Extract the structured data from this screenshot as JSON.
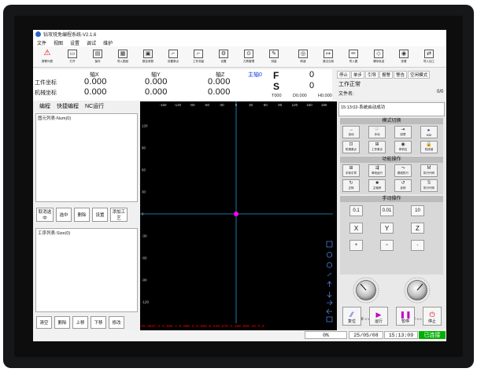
{
  "window": {
    "title": "钻攻铣免编程系统-V2.1.6"
  },
  "menu": [
    "文件",
    "视图",
    "设置",
    "调试",
    "维护"
  ],
  "toolbar": [
    {
      "label": "报警列表",
      "icon": "warning-icon"
    },
    {
      "label": "打开",
      "icon": "folder-icon"
    },
    {
      "label": "保存",
      "icon": "save-icon"
    },
    {
      "label": "导入图纸",
      "icon": "import-icon"
    },
    {
      "label": "数控参数",
      "icon": "cnc-params-icon"
    },
    {
      "label": "设置原点",
      "icon": "origin-icon"
    },
    {
      "label": "工件测量",
      "icon": "measure-icon"
    },
    {
      "label": "设置",
      "icon": "settings-icon"
    },
    {
      "label": "刀具管理",
      "icon": "tool-icon"
    },
    {
      "label": "测量",
      "icon": "probe-icon"
    },
    {
      "label": "转速",
      "icon": "spindle-icon"
    },
    {
      "label": "退出当前",
      "icon": "exit-icon"
    },
    {
      "label": "导入图",
      "icon": "import-drawing-icon"
    },
    {
      "label": "清除轨迹",
      "icon": "clear-icon"
    },
    {
      "label": "查看",
      "icon": "view-icon"
    },
    {
      "label": "导入加工",
      "icon": "transfer-icon"
    }
  ],
  "coords": {
    "axes": [
      "轴X",
      "轴Y",
      "轴Z"
    ],
    "work_label": "工件坐标",
    "machine_label": "机械坐标",
    "work": [
      "0.000",
      "0.000",
      "0.000"
    ],
    "machine": [
      "0.000",
      "0.000",
      "0.000"
    ],
    "spindle_label": "主轴0",
    "f_label": "F",
    "f_value": "0",
    "s_label": "S",
    "s_value": "0",
    "t_code": "T000",
    "d_code": "D0.000",
    "h_code": "H0.000"
  },
  "status_tabs": [
    "停止",
    "单步",
    "引导",
    "报警",
    "警告",
    "空闲模式"
  ],
  "work_status": "工作正常",
  "file_name_label": "文件名:",
  "file_count": "0/0",
  "left_tabs": [
    "编程",
    "快捷编程",
    "NC运行"
  ],
  "primitive_list": "图元列表-Num(0)",
  "process_list": "工序列表-Size(0)",
  "primitive_buttons": [
    "取消选中",
    "选中",
    "删除",
    "设置",
    "添加工艺"
  ],
  "process_buttons": [
    "清空",
    "删除",
    "上移",
    "下移",
    "修改"
  ],
  "viewport": {
    "x_ticks": [
      "-150",
      "-120",
      "-90",
      "-60",
      "-30",
      "0",
      "30",
      "60",
      "90",
      "120",
      "150",
      "180",
      "210"
    ],
    "y_ticks": [
      "150",
      "120",
      "90",
      "60",
      "30",
      "0",
      "-30",
      "-60",
      "-90",
      "-120"
    ],
    "status_line": "25:SDCP X 0.000 Y 0.000 Z 0.000 W 248.570 H 400.000 A0 P,0"
  },
  "message": "15:13:02-系统启动成功",
  "mode_section": "模式切换",
  "mode_buttons": [
    {
      "label": "自动",
      "icon": "auto-icon"
    },
    {
      "label": "手动",
      "icon": "manual-icon"
    },
    {
      "label": "回零",
      "icon": "home-icon"
    },
    {
      "label": "MDI",
      "icon": "mdi-icon"
    },
    {
      "label": "机械原点",
      "icon": "machine-origin-icon"
    },
    {
      "label": "工作原点",
      "icon": "work-origin-icon"
    },
    {
      "label": "停机位",
      "icon": "park-icon"
    },
    {
      "label": "机床锁",
      "icon": "lock-icon"
    }
  ],
  "function_section": "功能操作",
  "function_buttons": [
    {
      "label": "手轮引导",
      "icon": "handwheel-icon"
    },
    {
      "label": "单段运行",
      "icon": "single-block-icon"
    },
    {
      "label": "跳段执行",
      "icon": "skip-icon"
    },
    {
      "label": "执行代码",
      "icon": "m-code-icon"
    },
    {
      "label": "正转",
      "icon": "cw-icon"
    },
    {
      "label": "主轴停",
      "icon": "spindle-stop-icon"
    },
    {
      "label": "反转",
      "icon": "ccw-icon"
    },
    {
      "label": "执行代码",
      "icon": "s-code-icon"
    }
  ],
  "manual_section": "手动操作",
  "step_buttons": [
    "0.1",
    "0.01",
    "10"
  ],
  "axis_buttons": [
    "X",
    "Y",
    "Z"
  ],
  "plus_minus": [
    "+",
    "~",
    "-"
  ],
  "knob_labels": [
    "主轴倍率 ∿∿",
    "进给倍率 ∿∿"
  ],
  "control_buttons": [
    {
      "label": "复位",
      "icon": "reset-icon"
    },
    {
      "label": "运行",
      "icon": "run-icon"
    },
    {
      "label": "暂停",
      "icon": "pause-icon"
    },
    {
      "label": "停止",
      "icon": "stop-icon"
    }
  ],
  "statusbar": {
    "progress": "0%",
    "date": "25/05/08",
    "time": "15:13:09",
    "connection": "已连接"
  },
  "colors": {
    "accent": "#1a3de0",
    "origin_dot": "#ff00ff",
    "connected": "#00b000"
  }
}
